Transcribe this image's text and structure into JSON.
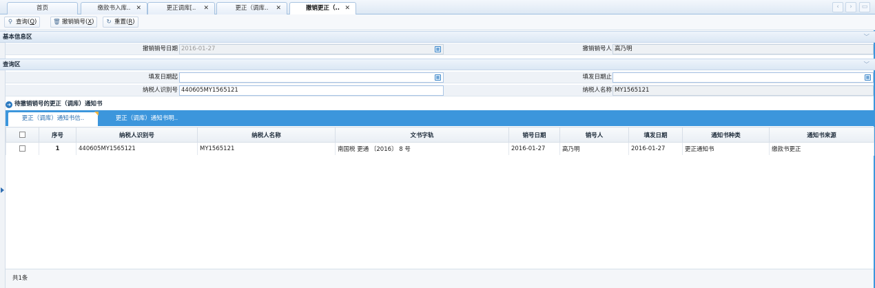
{
  "tabs": [
    {
      "label": "首页",
      "closable": false
    },
    {
      "label": "缴款书入库..",
      "closable": true
    },
    {
      "label": "更正调库[..",
      "closable": true
    },
    {
      "label": "更正（调库..",
      "closable": true
    },
    {
      "label": "撤销更正（..",
      "closable": true,
      "active": true
    }
  ],
  "toolbar": {
    "query_label": "查询(",
    "query_key": "Q",
    "revoke_label": "撤销销号(",
    "revoke_key": "X",
    "reset_label": "重置(",
    "reset_key": "R",
    "close_paren": ")"
  },
  "basic": {
    "title": "基本信息区",
    "revoke_date_label": "撤销销号日期",
    "revoke_date_value": "2016-01-27",
    "revoke_person_label": "撤销销号人",
    "revoke_person_value": "高乃明"
  },
  "query": {
    "title": "查询区",
    "fill_start_label": "填发日期起",
    "fill_start_value": "",
    "fill_end_label": "填发日期止",
    "fill_end_value": "",
    "taxpayer_id_label": "纳税人识别号",
    "taxpayer_id_value": "440605MY1565121",
    "taxpayer_name_label": "纳税人名称",
    "taxpayer_name_value": "MY1565121"
  },
  "list": {
    "title": "待撤销销号的更正（调库）通知书",
    "subtabs": [
      "更正（调库）通知书信..",
      "更正（调库）通知书明.."
    ],
    "columns": [
      "序号",
      "纳税人识别号",
      "纳税人名称",
      "文书字轨",
      "销号日期",
      "销号人",
      "填发日期",
      "通知书种类",
      "通知书来源"
    ],
    "rows": [
      [
        "1",
        "440605MY1565121",
        "MY1565121",
        "南国税 更通 〔2016〕 8 号",
        "2016-01-27",
        "高乃明",
        "2016-01-27",
        "更正通知书",
        "缴款书更正"
      ]
    ],
    "footer": "共1条"
  }
}
